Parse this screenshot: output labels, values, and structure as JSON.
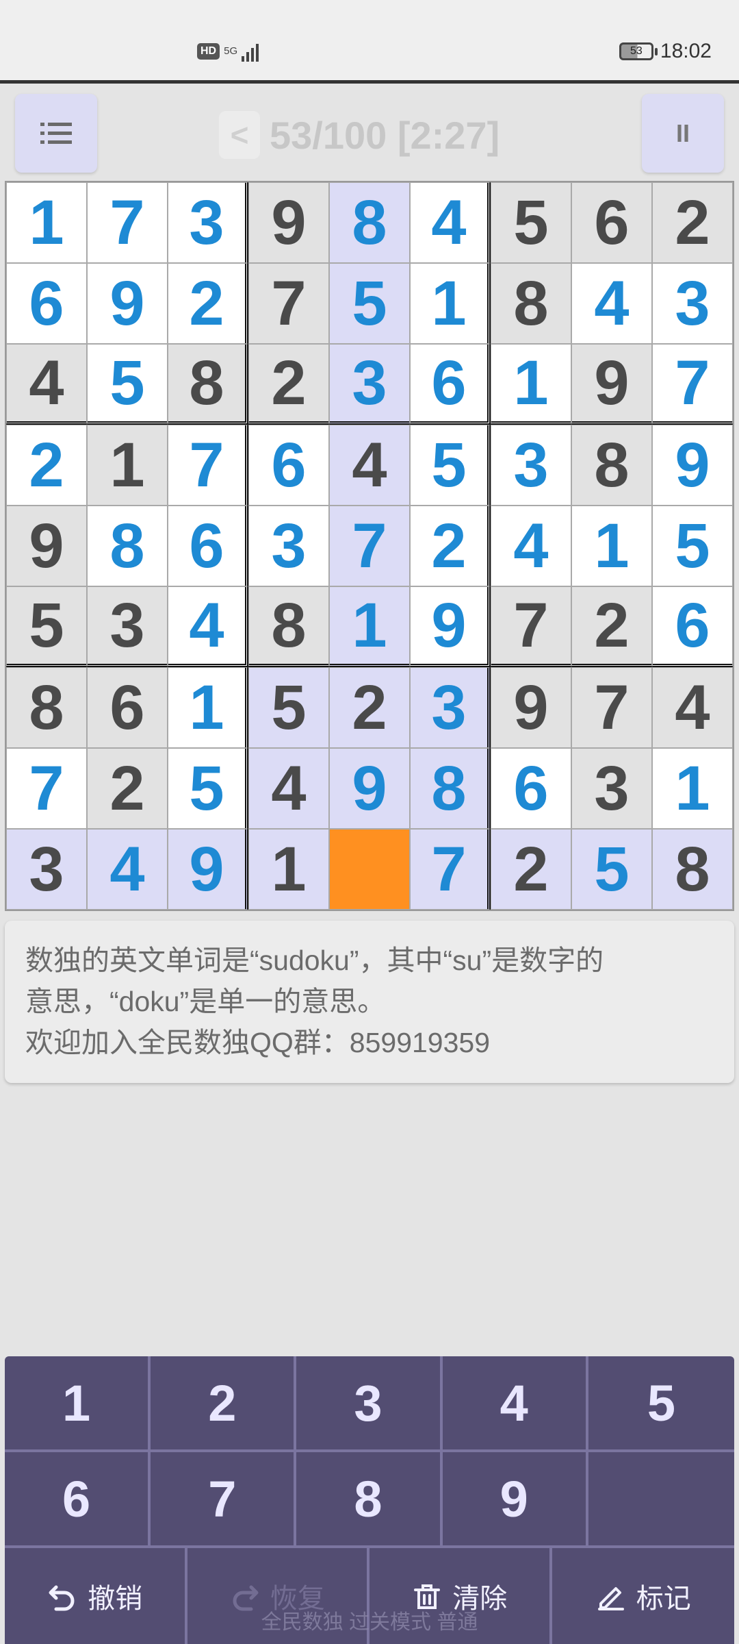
{
  "status_bar": {
    "hd": "HD",
    "network": "5G",
    "battery": "53",
    "time": "18:02"
  },
  "toolbar": {
    "menu_icon": "menu-icon",
    "back_label": "<",
    "title": "53/100 [2:27]",
    "pause_label": "II"
  },
  "board": {
    "selected_cell": {
      "row": 8,
      "col": 4
    },
    "colors": {
      "given_text": "#4a4a4a",
      "user_text": "#1e8ad4",
      "selected": "#ff9020",
      "highlight": "#dcdcf6",
      "given_bg": "#e2e2e2",
      "user_bg": "#ffffff"
    },
    "rows": [
      [
        "1",
        "7",
        "3",
        "9",
        "8",
        "4",
        "5",
        "6",
        "2"
      ],
      [
        "6",
        "9",
        "2",
        "7",
        "5",
        "1",
        "8",
        "4",
        "3"
      ],
      [
        "4",
        "5",
        "8",
        "2",
        "3",
        "6",
        "1",
        "9",
        "7"
      ],
      [
        "2",
        "1",
        "7",
        "6",
        "4",
        "5",
        "3",
        "8",
        "9"
      ],
      [
        "9",
        "8",
        "6",
        "3",
        "7",
        "2",
        "4",
        "1",
        "5"
      ],
      [
        "5",
        "3",
        "4",
        "8",
        "1",
        "9",
        "7",
        "2",
        "6"
      ],
      [
        "8",
        "6",
        "1",
        "5",
        "2",
        "3",
        "9",
        "7",
        "4"
      ],
      [
        "7",
        "2",
        "5",
        "4",
        "9",
        "8",
        "6",
        "3",
        "1"
      ],
      [
        "3",
        "4",
        "9",
        "1",
        "",
        "7",
        "2",
        "5",
        "8"
      ]
    ],
    "given": [
      [
        0,
        0,
        0,
        1,
        0,
        0,
        1,
        1,
        1
      ],
      [
        0,
        0,
        0,
        1,
        0,
        0,
        1,
        0,
        0
      ],
      [
        1,
        0,
        1,
        1,
        0,
        0,
        0,
        1,
        0
      ],
      [
        0,
        1,
        0,
        0,
        1,
        0,
        0,
        1,
        0
      ],
      [
        1,
        0,
        0,
        0,
        0,
        0,
        0,
        0,
        0
      ],
      [
        1,
        1,
        0,
        1,
        0,
        0,
        1,
        1,
        0
      ],
      [
        1,
        1,
        0,
        1,
        1,
        0,
        1,
        1,
        1
      ],
      [
        0,
        1,
        0,
        1,
        0,
        0,
        0,
        1,
        0
      ],
      [
        1,
        0,
        0,
        1,
        0,
        0,
        1,
        0,
        1
      ]
    ]
  },
  "tip": {
    "line1": "数独的英文单词是“sudoku”，其中“su”是数字的",
    "line2": "意思，“doku”是单一的意思。",
    "line3": "欢迎加入全民数独QQ群：859919359"
  },
  "keypad": {
    "numbers": [
      "1",
      "2",
      "3",
      "4",
      "5",
      "6",
      "7",
      "8",
      "9",
      ""
    ],
    "actions": [
      {
        "label": "撤销",
        "icon": "undo-icon",
        "enabled": true
      },
      {
        "label": "恢复",
        "icon": "redo-icon",
        "enabled": false
      },
      {
        "label": "清除",
        "icon": "trash-icon",
        "enabled": true
      },
      {
        "label": "标记",
        "icon": "pencil-icon",
        "enabled": true
      }
    ]
  },
  "footer": "全民数独 过关模式 普通"
}
